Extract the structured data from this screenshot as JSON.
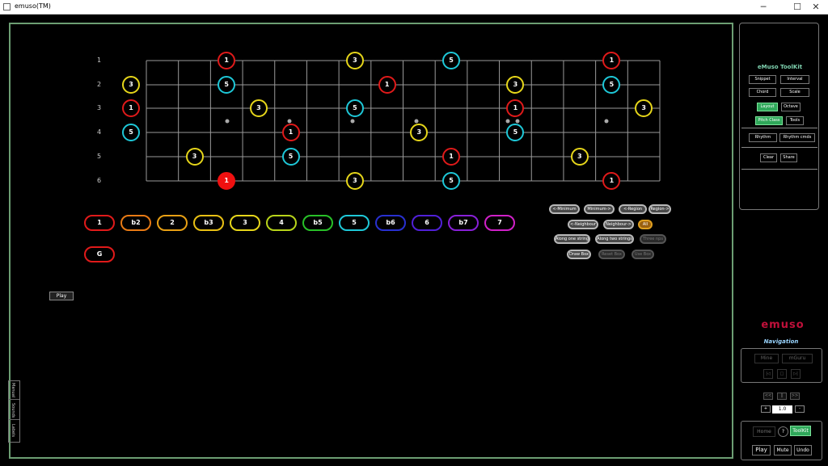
{
  "window": {
    "title": "emuso(TM)",
    "minimize": "─",
    "maximize": "☐",
    "close": "✕"
  },
  "strings": [
    {
      "num": "1"
    },
    {
      "num": "2"
    },
    {
      "num": "3"
    },
    {
      "num": "4"
    },
    {
      "num": "5"
    },
    {
      "num": "6"
    }
  ],
  "notes": [
    {
      "string": 1,
      "fret": 3,
      "label": "1",
      "color": "c1"
    },
    {
      "string": 1,
      "fret": 7,
      "label": "3",
      "color": "c3"
    },
    {
      "string": 1,
      "fret": 10,
      "label": "5",
      "color": "c5"
    },
    {
      "string": 1,
      "fret": 15,
      "label": "1",
      "color": "c1"
    },
    {
      "string": 2,
      "fret": 0,
      "label": "3",
      "color": "c3"
    },
    {
      "string": 2,
      "fret": 3,
      "label": "5",
      "color": "c5"
    },
    {
      "string": 2,
      "fret": 8,
      "label": "1",
      "color": "c1"
    },
    {
      "string": 2,
      "fret": 12,
      "label": "3",
      "color": "c3"
    },
    {
      "string": 2,
      "fret": 15,
      "label": "5",
      "color": "c5"
    },
    {
      "string": 3,
      "fret": 0,
      "label": "1",
      "color": "c1"
    },
    {
      "string": 3,
      "fret": 4,
      "label": "3",
      "color": "c3"
    },
    {
      "string": 3,
      "fret": 7,
      "label": "5",
      "color": "c5"
    },
    {
      "string": 3,
      "fret": 12,
      "label": "1",
      "color": "c1"
    },
    {
      "string": 3,
      "fret": 16,
      "label": "3",
      "color": "c3"
    },
    {
      "string": 4,
      "fret": 0,
      "label": "5",
      "color": "c5"
    },
    {
      "string": 4,
      "fret": 5,
      "label": "1",
      "color": "c1"
    },
    {
      "string": 4,
      "fret": 9,
      "label": "3",
      "color": "c3"
    },
    {
      "string": 4,
      "fret": 12,
      "label": "5",
      "color": "c5"
    },
    {
      "string": 5,
      "fret": 2,
      "label": "3",
      "color": "c3"
    },
    {
      "string": 5,
      "fret": 5,
      "label": "5",
      "color": "c5"
    },
    {
      "string": 5,
      "fret": 10,
      "label": "1",
      "color": "c1"
    },
    {
      "string": 5,
      "fret": 14,
      "label": "3",
      "color": "c3"
    },
    {
      "string": 6,
      "fret": 3,
      "label": "1",
      "color": "root"
    },
    {
      "string": 6,
      "fret": 7,
      "label": "3",
      "color": "c3"
    },
    {
      "string": 6,
      "fret": 10,
      "label": "5",
      "color": "c5"
    },
    {
      "string": 6,
      "fret": 15,
      "label": "1",
      "color": "c1"
    }
  ],
  "degrees": [
    {
      "label": "1",
      "color": "#e01a1a"
    },
    {
      "label": "b2",
      "color": "#e87a14"
    },
    {
      "label": "2",
      "color": "#e8a014"
    },
    {
      "label": "b3",
      "color": "#e8c014"
    },
    {
      "label": "3",
      "color": "#e6d61a"
    },
    {
      "label": "4",
      "color": "#b8d41a"
    },
    {
      "label": "b5",
      "color": "#28c028"
    },
    {
      "label": "5",
      "color": "#1ec8d8"
    },
    {
      "label": "b6",
      "color": "#2830d0"
    },
    {
      "label": "6",
      "color": "#5020d8"
    },
    {
      "label": "b7",
      "color": "#8820d8"
    },
    {
      "label": "7",
      "color": "#d020c8"
    }
  ],
  "key_label": "G",
  "region_buttons": [
    {
      "label": "<-Minimum",
      "state": "on"
    },
    {
      "label": "Minimum->",
      "state": "on"
    },
    {
      "label": "<-Region",
      "state": "on"
    },
    {
      "label": "Region->",
      "state": "on"
    },
    {
      "label": "<-Neighbour",
      "state": "on"
    },
    {
      "label": "Neighbour->",
      "state": "on"
    },
    {
      "label": "All",
      "state": "orange"
    },
    {
      "label": "Along one string",
      "state": "on"
    },
    {
      "label": "Along two strings",
      "state": "on"
    },
    {
      "label": "Three nps",
      "state": "dim"
    },
    {
      "label": "Draw Box",
      "state": "on"
    },
    {
      "label": "Reset Box",
      "state": "dim"
    },
    {
      "label": "Use Box",
      "state": "dim"
    }
  ],
  "play_label": "Play",
  "side_tabs": [
    "Manual",
    "Sounds",
    "Labels"
  ],
  "toolkit": {
    "title": "eMuso ToolKit",
    "buttons": [
      "Snippet",
      "Interval",
      "Chord",
      "Scale",
      "Layout",
      "Octave",
      "Pitch Class",
      "Tools",
      "Rhythm",
      "Rhythm cmds",
      "Clear",
      "Share"
    ]
  },
  "logo": "emuso",
  "navigation": {
    "label": "Navigation",
    "mine": "Mine",
    "mguru": "mGuru",
    "prev": "|◁",
    "stop": "□",
    "next": "▷|",
    "rew": "<<",
    "pause": "||",
    "fwd": ">>",
    "minus": "-",
    "plus": "+",
    "speed": "1.0"
  },
  "home": {
    "home": "Home",
    "help": "?",
    "toolkit": "ToolKit",
    "play": "Play",
    "mute": "Mute",
    "undo": "Undo"
  }
}
